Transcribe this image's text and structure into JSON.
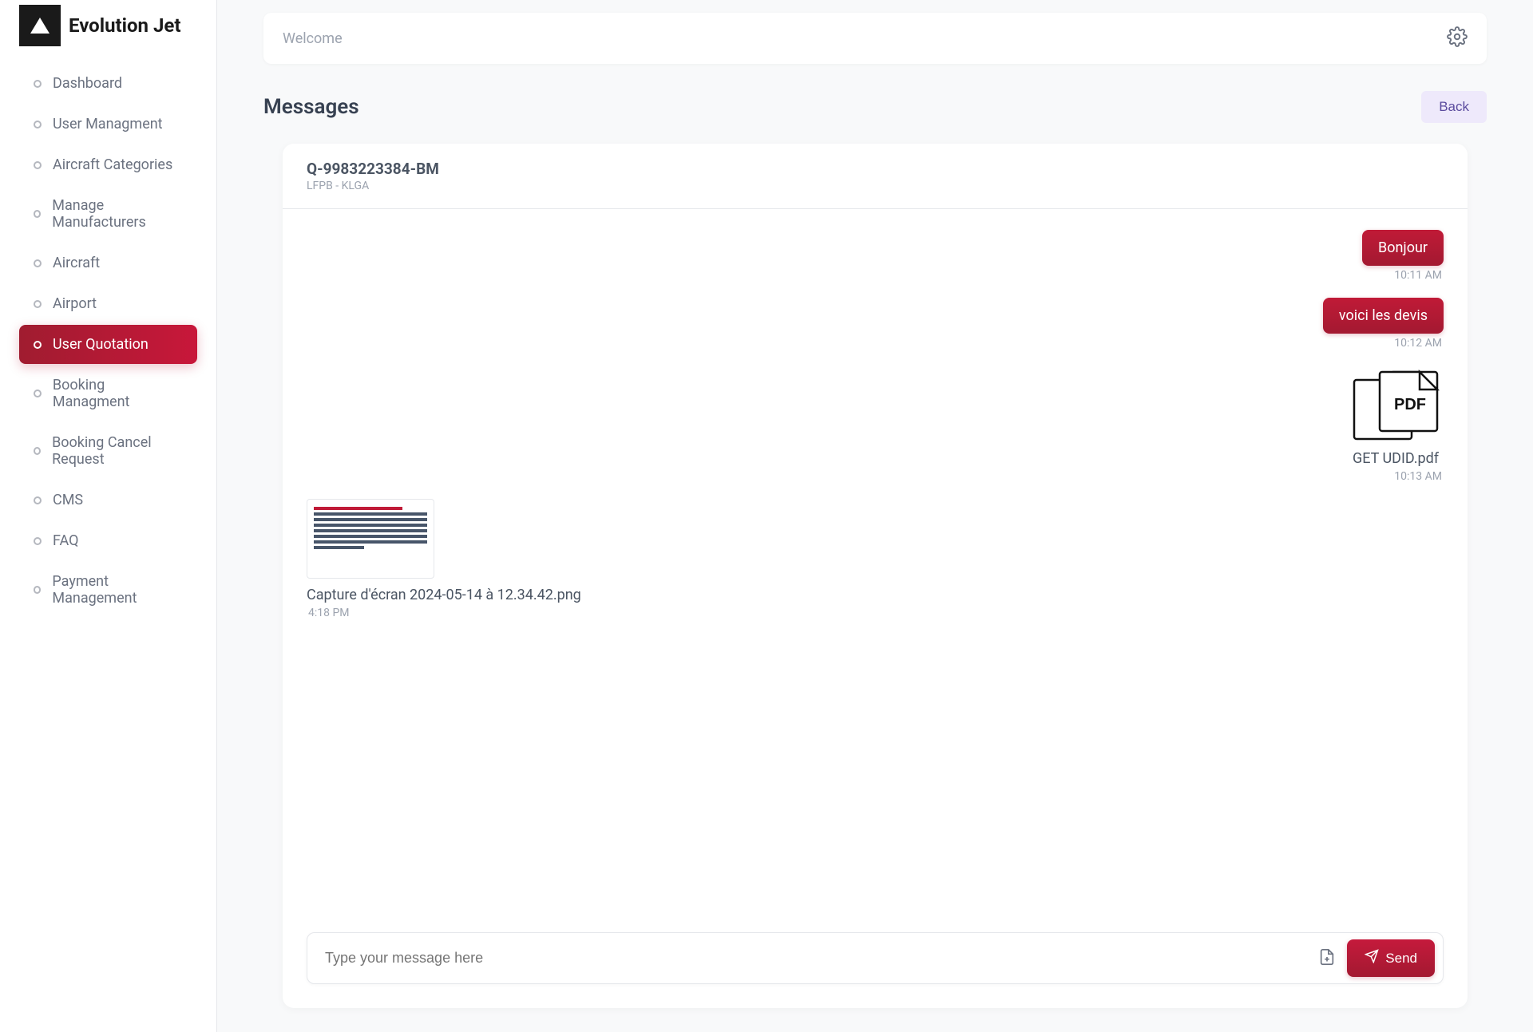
{
  "brand": {
    "name": "Evolution Jet"
  },
  "sidebar": {
    "items": [
      {
        "label": "Dashboard"
      },
      {
        "label": "User Managment"
      },
      {
        "label": "Aircraft Categories"
      },
      {
        "label": "Manage Manufacturers"
      },
      {
        "label": "Aircraft"
      },
      {
        "label": "Airport"
      },
      {
        "label": "User Quotation",
        "active": true
      },
      {
        "label": "Booking Managment"
      },
      {
        "label": "Booking Cancel Request"
      },
      {
        "label": "CMS"
      },
      {
        "label": "FAQ"
      },
      {
        "label": "Payment Management"
      }
    ]
  },
  "topbar": {
    "welcome": "Welcome"
  },
  "page": {
    "title": "Messages",
    "back_label": "Back"
  },
  "chat": {
    "quote_id": "Q-9983223384-BM",
    "route": "LFPB - KLGA",
    "messages": [
      {
        "side": "right",
        "type": "text",
        "text": "Bonjour",
        "ts": "10:11 AM"
      },
      {
        "side": "right",
        "type": "text",
        "text": "voici les devis",
        "ts": "10:12 AM"
      },
      {
        "side": "right",
        "type": "pdf",
        "name": "GET UDID.pdf",
        "ts": "10:13 AM"
      },
      {
        "side": "left",
        "type": "image",
        "name": "Capture d'écran 2024-05-14 à 12.34.42.png",
        "ts": "4:18 PM"
      }
    ],
    "composer": {
      "placeholder": "Type your message here",
      "send_label": "Send"
    }
  }
}
